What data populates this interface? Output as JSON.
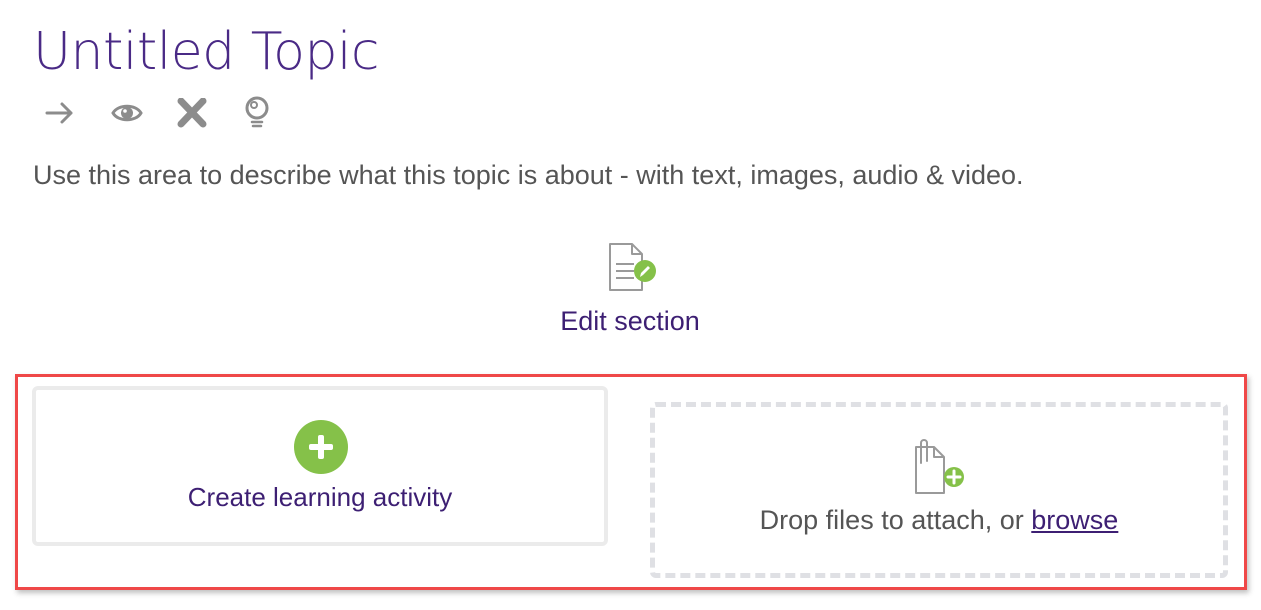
{
  "page": {
    "title": "Untitled Topic",
    "description": "Use this area to describe what this topic is about - with text, images, audio & video."
  },
  "toolbar": {
    "items": [
      {
        "icon": "arrow-right-icon",
        "label": "Move"
      },
      {
        "icon": "eye-icon",
        "label": "Show/Hide"
      },
      {
        "icon": "close-icon",
        "label": "Delete"
      },
      {
        "icon": "lightbulb-icon",
        "label": "Highlight"
      }
    ]
  },
  "edit_section": {
    "icon": "document-edit-icon",
    "label": "Edit section"
  },
  "create_activity": {
    "icon": "plus-circle-icon",
    "label": "Create learning activity"
  },
  "drop_zone": {
    "icon": "attach-file-add-icon",
    "text": "Drop files to attach, or ",
    "link": "browse"
  },
  "colors": {
    "title": "#4a2a86",
    "link": "#3d1f73",
    "accent_green": "#85c149",
    "icon_gray": "#8c8c8c",
    "highlight_frame": "#ef4848",
    "text": "#555555"
  }
}
